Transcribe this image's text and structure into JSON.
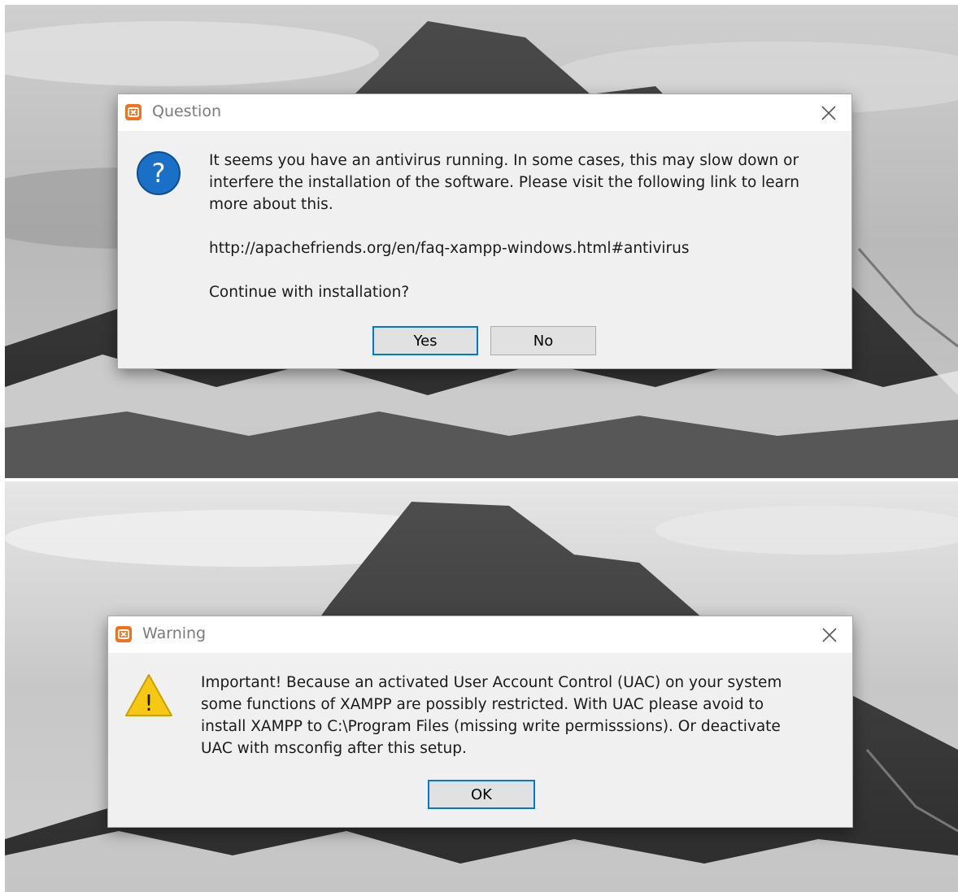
{
  "question_dialog": {
    "title": "Question",
    "message_lines": [
      "It seems you have an antivirus running. In some cases, this may slow down or",
      "interfere the installation of the software. Please visit the following link to learn",
      "more about this."
    ],
    "link": "http://apachefriends.org/en/faq-xampp-windows.html#antivirus",
    "prompt": "Continue with installation?",
    "yes_label": "Yes",
    "no_label": "No",
    "icon": "question-icon"
  },
  "warning_dialog": {
    "title": "Warning",
    "message_lines": [
      "Important! Because an activated User Account Control (UAC) on your system",
      "some functions of XAMPP are possibly restricted. With UAC please avoid to",
      "install XAMPP to C:\\Program Files (missing write permisssions). Or deactivate",
      "UAC with msconfig after this setup."
    ],
    "ok_label": "OK",
    "icon": "warning-icon"
  },
  "colors": {
    "dialog_bg": "#f0f0f0",
    "titlebar_bg": "#ffffff",
    "default_button_border": "#0078d7",
    "app_icon": "#f2711c",
    "question_icon": "#1a6fc6",
    "warning_icon": "#f6c813"
  }
}
